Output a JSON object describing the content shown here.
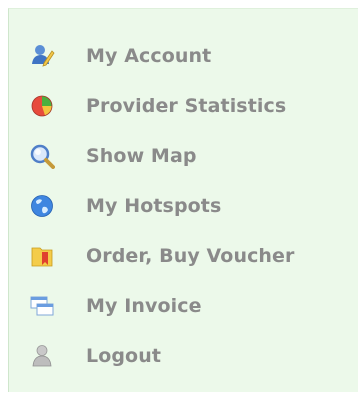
{
  "menu": {
    "items": [
      {
        "label": "My Account",
        "icon": "user-account-icon"
      },
      {
        "label": "Provider Statistics",
        "icon": "pie-chart-icon"
      },
      {
        "label": "Show Map",
        "icon": "magnifier-icon"
      },
      {
        "label": "My Hotspots",
        "icon": "globe-icon"
      },
      {
        "label": "Order, Buy Voucher",
        "icon": "folder-bookmark-icon"
      },
      {
        "label": "My Invoice",
        "icon": "windows-icon"
      },
      {
        "label": "Logout",
        "icon": "person-icon"
      }
    ]
  },
  "colors": {
    "panel_background": "#ecf9ea",
    "label_text": "#8a8a8a"
  }
}
